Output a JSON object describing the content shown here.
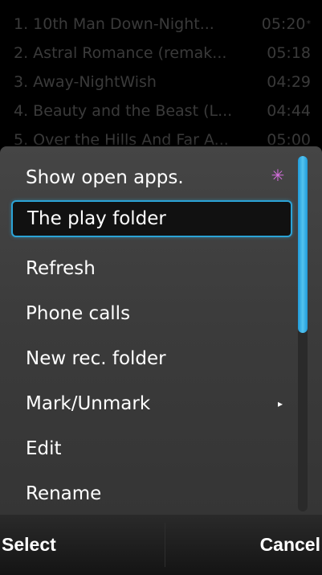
{
  "tracklist": {
    "tracks": [
      {
        "title": "1. 10th Man Down-Night...",
        "duration": "05:20",
        "mark": "*"
      },
      {
        "title": "2. Astral Romance (remak...",
        "duration": "05:18"
      },
      {
        "title": "3. Away-NightWish",
        "duration": "04:29"
      },
      {
        "title": "4. Beauty and the Beast (L...",
        "duration": "04:44"
      },
      {
        "title": "5. Over the Hills And Far A...",
        "duration": "05:00"
      }
    ]
  },
  "menu": {
    "items": [
      {
        "label": "Show open apps.",
        "icon": "task-switcher-icon"
      },
      {
        "label": "The play folder",
        "selected": true
      },
      {
        "label": "Refresh"
      },
      {
        "label": "Phone calls"
      },
      {
        "label": "New rec. folder"
      },
      {
        "label": "Mark/Unmark",
        "submenu": true
      },
      {
        "label": "Edit"
      },
      {
        "label": "Rename"
      }
    ],
    "scroll_position": 0,
    "accent_color": "#2ba3d6"
  },
  "softkeys": {
    "left": "Select",
    "right": "Cancel"
  }
}
